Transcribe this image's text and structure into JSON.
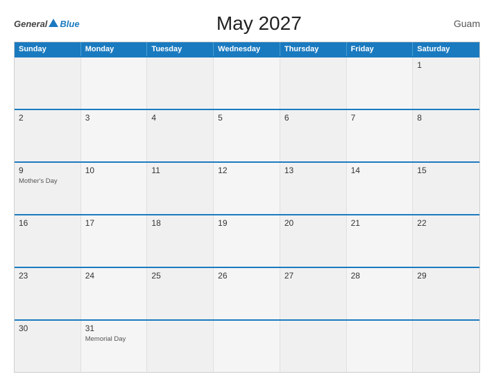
{
  "header": {
    "title": "May 2027",
    "region": "Guam",
    "logo": {
      "general": "General",
      "blue": "Blue"
    }
  },
  "days_of_week": [
    "Sunday",
    "Monday",
    "Tuesday",
    "Wednesday",
    "Thursday",
    "Friday",
    "Saturday"
  ],
  "weeks": [
    [
      {
        "day": "",
        "event": ""
      },
      {
        "day": "",
        "event": ""
      },
      {
        "day": "",
        "event": ""
      },
      {
        "day": "",
        "event": ""
      },
      {
        "day": "",
        "event": ""
      },
      {
        "day": "",
        "event": ""
      },
      {
        "day": "1",
        "event": ""
      }
    ],
    [
      {
        "day": "2",
        "event": ""
      },
      {
        "day": "3",
        "event": ""
      },
      {
        "day": "4",
        "event": ""
      },
      {
        "day": "5",
        "event": ""
      },
      {
        "day": "6",
        "event": ""
      },
      {
        "day": "7",
        "event": ""
      },
      {
        "day": "8",
        "event": ""
      }
    ],
    [
      {
        "day": "9",
        "event": "Mother's Day"
      },
      {
        "day": "10",
        "event": ""
      },
      {
        "day": "11",
        "event": ""
      },
      {
        "day": "12",
        "event": ""
      },
      {
        "day": "13",
        "event": ""
      },
      {
        "day": "14",
        "event": ""
      },
      {
        "day": "15",
        "event": ""
      }
    ],
    [
      {
        "day": "16",
        "event": ""
      },
      {
        "day": "17",
        "event": ""
      },
      {
        "day": "18",
        "event": ""
      },
      {
        "day": "19",
        "event": ""
      },
      {
        "day": "20",
        "event": ""
      },
      {
        "day": "21",
        "event": ""
      },
      {
        "day": "22",
        "event": ""
      }
    ],
    [
      {
        "day": "23",
        "event": ""
      },
      {
        "day": "24",
        "event": ""
      },
      {
        "day": "25",
        "event": ""
      },
      {
        "day": "26",
        "event": ""
      },
      {
        "day": "27",
        "event": ""
      },
      {
        "day": "28",
        "event": ""
      },
      {
        "day": "29",
        "event": ""
      }
    ],
    [
      {
        "day": "30",
        "event": ""
      },
      {
        "day": "31",
        "event": "Memorial Day"
      },
      {
        "day": "",
        "event": ""
      },
      {
        "day": "",
        "event": ""
      },
      {
        "day": "",
        "event": ""
      },
      {
        "day": "",
        "event": ""
      },
      {
        "day": "",
        "event": ""
      }
    ]
  ]
}
